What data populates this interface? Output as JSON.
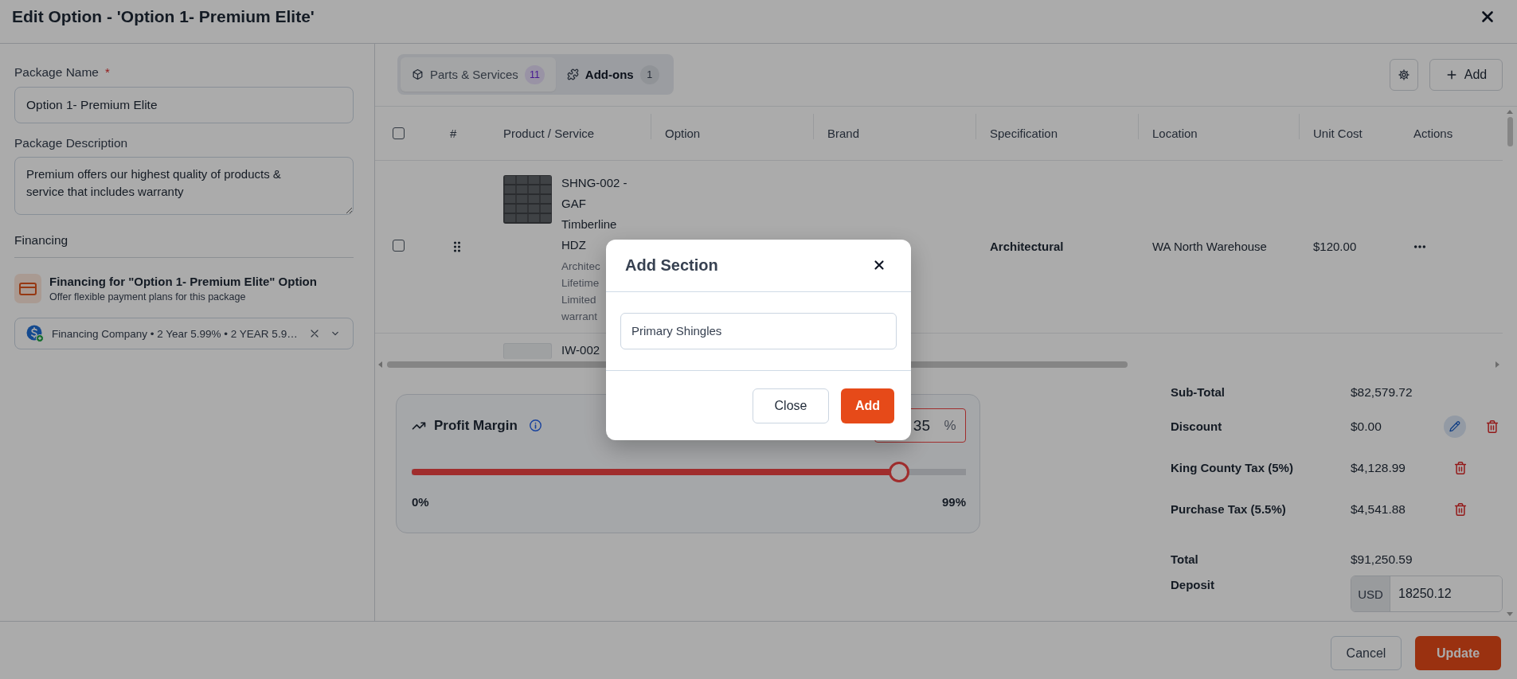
{
  "window": {
    "title": "Edit Option - 'Option 1- Premium Elite'"
  },
  "package_name": {
    "label": "Package Name",
    "required_mark": "*",
    "value": "Option 1- Premium Elite"
  },
  "package_description": {
    "label": "Package Description",
    "value": "Premium offers our highest quality of products & service that includes warranty"
  },
  "financing": {
    "heading": "Financing",
    "title": "Financing for \"Option 1- Premium Elite\" Option",
    "subtitle": "Offer flexible payment plans for this package",
    "selection": "Financing Company • 2 Year 5.99% • 2 YEAR 5.9…"
  },
  "tabs": [
    {
      "kind": "parts",
      "label": "Parts & Services",
      "count": "11",
      "selected": true
    },
    {
      "kind": "addons",
      "label": "Add-ons",
      "count": "1",
      "selected": false
    }
  ],
  "toolbar": {
    "add_button": "Add"
  },
  "table": {
    "header_checked": false,
    "columns": [
      "#",
      "Product / Service",
      "Option",
      "Brand",
      "Specification",
      "Location",
      "Unit Cost",
      "Actions"
    ],
    "rows": [
      {
        "checked": false,
        "name": "SHNG-002 - GAF Timberline HDZ",
        "description": "Architec\nLifetime\nLimited\nwarrant",
        "specification": "Architectural",
        "location": "WA North Warehouse",
        "unit_cost": "$120.00"
      }
    ],
    "clipped_row": {
      "name": "IW-002"
    }
  },
  "profit_margin": {
    "title": "Profit Margin",
    "value": "35",
    "unit": "%",
    "level": 0.88,
    "min_label": "0%",
    "max_label": "99%"
  },
  "summary": [
    {
      "label": "Sub-Total",
      "value": "$82,579.72",
      "editable": false,
      "removable": false
    },
    {
      "label": "Discount",
      "value": "$0.00",
      "editable": true,
      "removable": true
    },
    {
      "label": "King County Tax (5%)",
      "value": "$4,128.99",
      "editable": false,
      "removable": true
    },
    {
      "label": "Purchase Tax (5.5%)",
      "value": "$4,541.88",
      "editable": false,
      "removable": true
    }
  ],
  "total": {
    "label": "Total",
    "value": "$91,250.59"
  },
  "deposit": {
    "label": "Deposit",
    "currency": "USD",
    "value": "18250.12"
  },
  "footer": {
    "cancel": "Cancel",
    "update": "Update"
  },
  "dialog": {
    "title": "Add Section",
    "field_value": "Primary Shingles",
    "close_button": "Close",
    "add_button": "Add"
  }
}
